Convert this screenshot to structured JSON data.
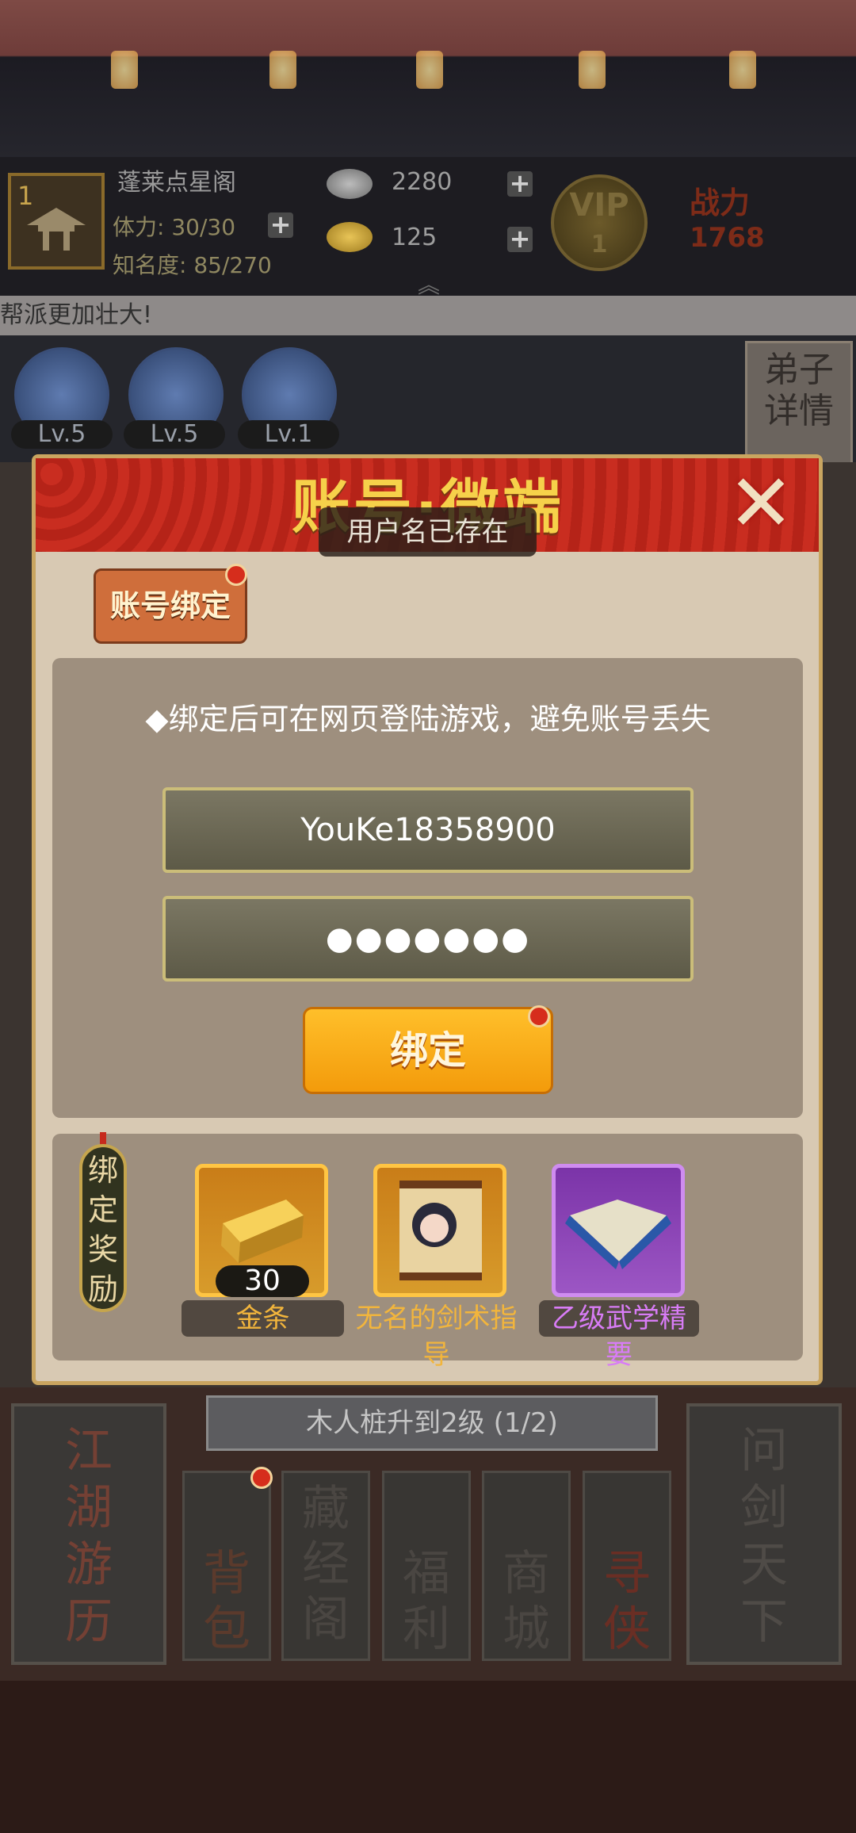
{
  "hud": {
    "level": "1",
    "sect_name": "蓬莱点星阁",
    "stamina_label": "体力:",
    "stamina_value": "30/30",
    "fame_label": "知名度:",
    "fame_value": "85/270",
    "silver": "2280",
    "gold": "125",
    "vip_label": "VIP",
    "vip_level": "1",
    "power_label": "战力",
    "power_value": "1768"
  },
  "notice_text": "帮派更加壮大!",
  "disciples": [
    {
      "level": "Lv.5"
    },
    {
      "level": "Lv.5"
    },
    {
      "level": "Lv.1"
    }
  ],
  "disciple_detail_label": "弟子详情",
  "modal": {
    "title": "账号·微端",
    "close_icon": "close-x-icon",
    "toast": "用户名已存在",
    "tab_label": "账号绑定",
    "hint": "◆绑定后可在网页登陆游戏，避免账号丢失",
    "username_value": "YouKe18358900",
    "password_value": "●●●●●●●",
    "bind_label": "绑定",
    "reward_label": "绑定奖励",
    "rewards": [
      {
        "name": "金条",
        "count": "30",
        "color": "#f2b53c"
      },
      {
        "name": "无名的剑术指导",
        "color": "#f2b53c"
      },
      {
        "name": "乙级武学精要",
        "color": "#d87cf6"
      }
    ]
  },
  "task_text": "木人桩升到2级  (1/2)",
  "bottom_nav": {
    "left_big": "江湖游历",
    "items": [
      "背包",
      "藏经阁",
      "福利",
      "商城",
      "寻侠"
    ],
    "right_big": "问剑天下"
  },
  "colors": {
    "modal_header_red": "#c92d20",
    "bind_button_orange": "#f9a51a",
    "gold_frame": "#ffc543",
    "purple_frame": "#cf8cf0"
  }
}
